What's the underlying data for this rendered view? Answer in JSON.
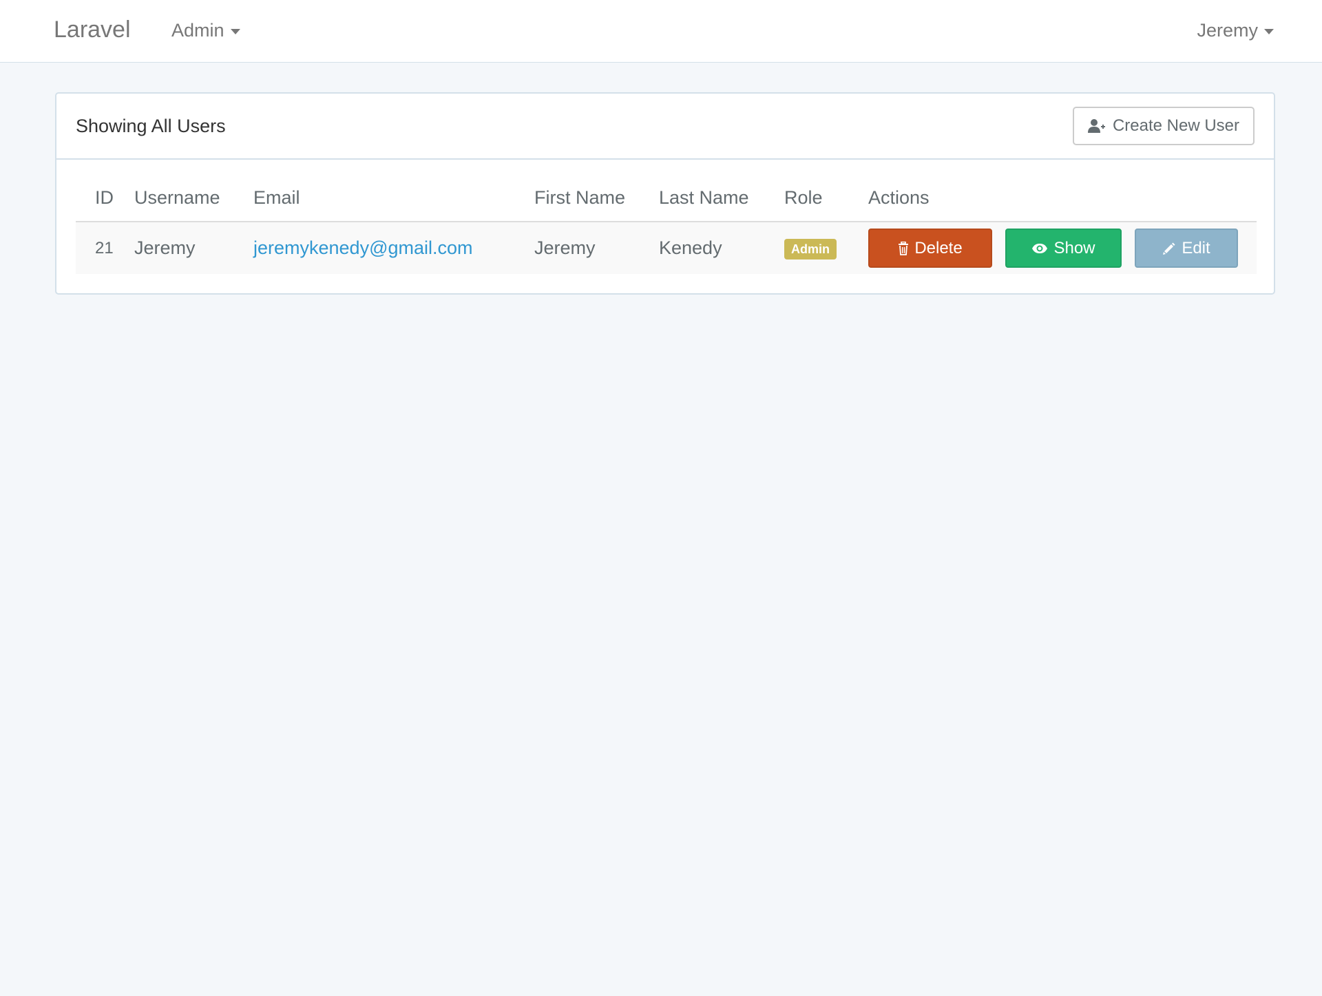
{
  "navbar": {
    "brand": "Laravel",
    "admin_menu": "Admin",
    "user_menu": "Jeremy"
  },
  "panel": {
    "title": "Showing All Users",
    "create_button": "Create New User"
  },
  "table": {
    "headers": [
      "ID",
      "Username",
      "Email",
      "First Name",
      "Last Name",
      "Role",
      "Actions"
    ],
    "rows": [
      {
        "id": "21",
        "username": "Jeremy",
        "email": "jeremykenedy@gmail.com",
        "first_name": "Jeremy",
        "last_name": "Kenedy",
        "role": "Admin",
        "actions": {
          "delete": "Delete",
          "show": "Show",
          "edit": "Edit"
        }
      }
    ]
  },
  "colors": {
    "background": "#f4f7fa",
    "link": "#3097d1",
    "delete": "#c9511f",
    "show": "#23b46d",
    "edit": "#8eb4cb",
    "role_badge": "#cbb956"
  },
  "icons": {
    "create_button": "user-plus-icon",
    "delete": "trash-icon",
    "show": "eye-icon",
    "edit": "pencil-icon"
  }
}
